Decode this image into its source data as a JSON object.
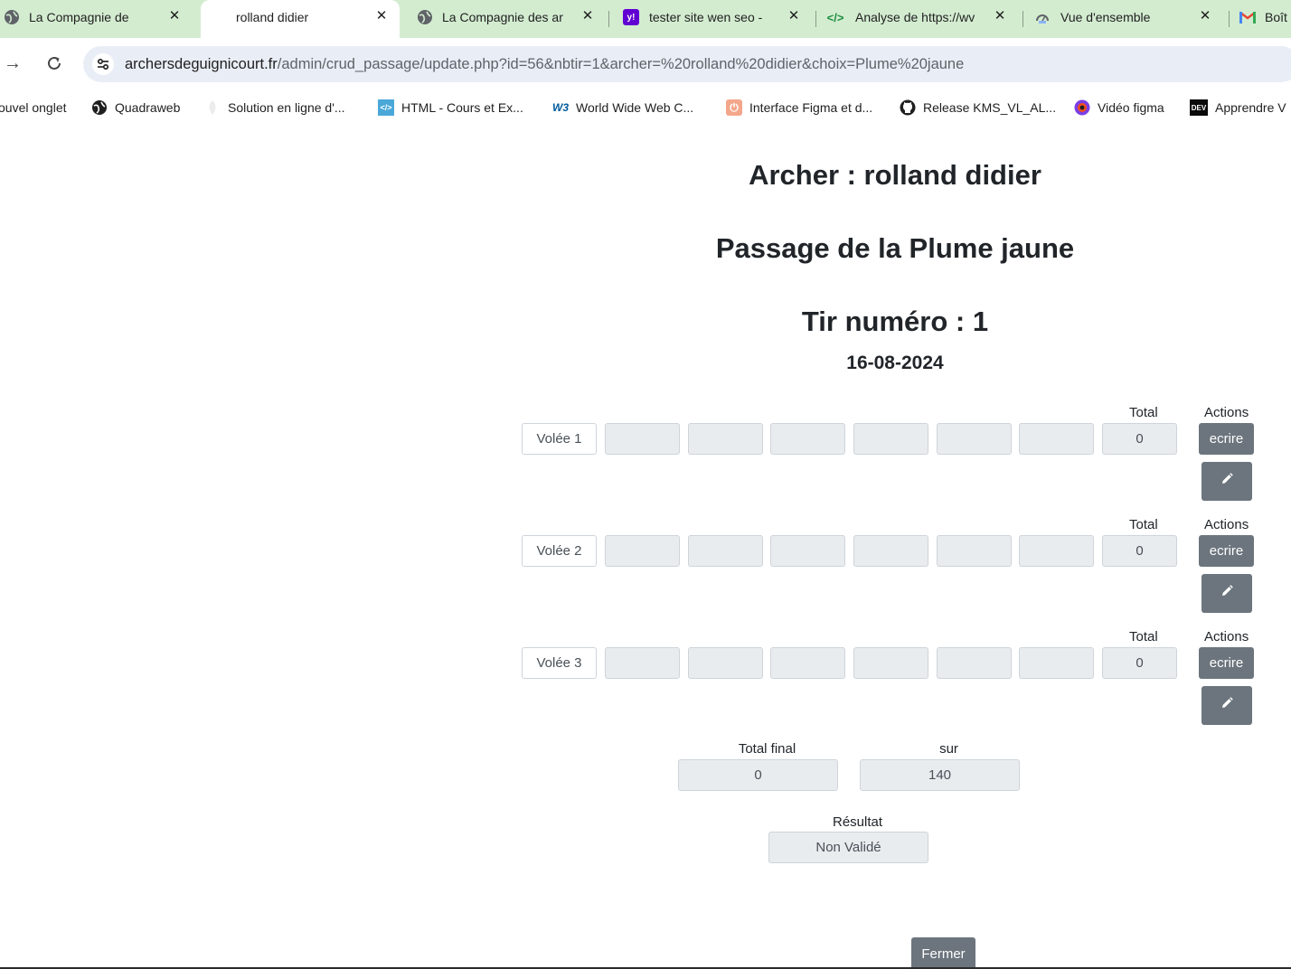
{
  "browser": {
    "tabs": [
      {
        "title": "La Compagnie des ar",
        "icon": "globe-icon"
      },
      {
        "title": "rolland didier",
        "icon": "none"
      },
      {
        "title": "La Compagnie des ar",
        "icon": "globe-icon"
      },
      {
        "title": "tester site wen seo - ",
        "icon": "yahoo-icon"
      },
      {
        "title": "Analyse de https://wv",
        "icon": "code-icon"
      },
      {
        "title": "Vue d'ensemble",
        "icon": "dashboard-icon"
      },
      {
        "title": "Boît",
        "icon": "gmail-icon"
      }
    ],
    "url_domain": "archersdeguignicourt.fr",
    "url_path": "/admin/crud_passage/update.php?id=56&nbtir=1&archer=%20rolland%20didier&choix=Plume%20jaune",
    "bookmarks": [
      {
        "label": "ouvel onglet",
        "icon": "none"
      },
      {
        "label": "Quadraweb",
        "icon": "globe-icon"
      },
      {
        "label": "Solution en ligne d'...",
        "icon": "leaf-icon"
      },
      {
        "label": "HTML - Cours et Ex...",
        "icon": "code-icon"
      },
      {
        "label": "World Wide Web C...",
        "icon": "w3c-icon"
      },
      {
        "label": "Interface Figma et d...",
        "icon": "power-icon"
      },
      {
        "label": "Release KMS_VL_AL...",
        "icon": "github-icon"
      },
      {
        "label": "Vidéo figma",
        "icon": "figma-icon"
      },
      {
        "label": "Apprendre V",
        "icon": "dev-icon"
      }
    ],
    "bookmark_dev_badge": "DEV",
    "bookmark_w3_badge": "W3"
  },
  "page": {
    "archer_title": "Archer : rolland didier",
    "passage_title": "Passage de la Plume jaune",
    "tir_title": "Tir numéro : 1",
    "date": "16-08-2024",
    "total_header": "Total",
    "actions_header": "Actions",
    "ecrire_label": "ecrire",
    "volees": [
      {
        "label": "Volée 1",
        "total": "0",
        "scores": [
          "",
          "",
          "",
          "",
          "",
          "",
          ""
        ]
      },
      {
        "label": "Volée 2",
        "total": "0",
        "scores": [
          "",
          "",
          "",
          "",
          "",
          "",
          ""
        ]
      },
      {
        "label": "Volée 3",
        "total": "0",
        "scores": [
          "",
          "",
          "",
          "",
          "",
          "",
          ""
        ]
      }
    ],
    "total_final_label": "Total final",
    "total_final_value": "0",
    "sur_label": "sur",
    "sur_value": "140",
    "resultat_label": "Résultat",
    "resultat_value": "Non Validé",
    "fermer_label": "Fermer"
  },
  "colors": {
    "tabstrip": "#d3ecd0",
    "button_secondary": "#6c757d",
    "readonly_field": "#e9ecef",
    "omnibox": "#e9eef6"
  }
}
